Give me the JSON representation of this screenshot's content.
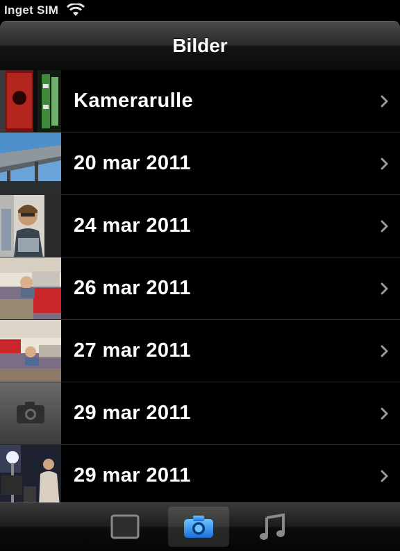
{
  "status_bar": {
    "carrier": "Inget SIM",
    "wifi_icon": "wifi-icon"
  },
  "nav": {
    "title": "Bilder"
  },
  "albums": [
    {
      "label": "Kamerarulle",
      "thumbnail": "camera-roll-thumbnail"
    },
    {
      "label": "20 mar 2011",
      "thumbnail": "bridge-photo-thumbnail"
    },
    {
      "label": "24 mar 2011",
      "thumbnail": "portrait-photo-thumbnail"
    },
    {
      "label": "26 mar 2011",
      "thumbnail": "bedroom-photo-thumbnail"
    },
    {
      "label": "27 mar 2011",
      "thumbnail": "bedroom-photo-thumbnail"
    },
    {
      "label": "29 mar 2011",
      "thumbnail": "camera-placeholder-icon"
    },
    {
      "label": "29 mar 2011",
      "thumbnail": "studio-photo-thumbnail"
    }
  ],
  "tabs": [
    {
      "icon": "square-icon",
      "active": false
    },
    {
      "icon": "camera-icon",
      "active": true
    },
    {
      "icon": "music-note-icon",
      "active": false
    }
  ],
  "colors": {
    "background": "#000000",
    "active_tab_accent": "#3aa0ff"
  }
}
